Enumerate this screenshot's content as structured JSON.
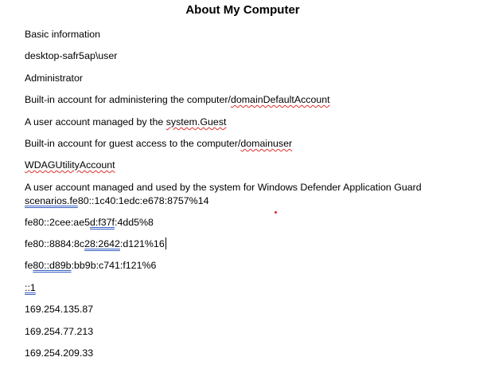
{
  "document": {
    "title": "About My Computer",
    "paragraphs": {
      "basic_info": "Basic information",
      "machine_user": "desktop-safr5ap\\user",
      "administrator": "Administrator",
      "admin_desc_prefix": "Built-in account for administering the computer/",
      "admin_desc_word": "domainDefaultAccount",
      "managed_prefix": "A user account managed by the ",
      "managed_word": "system.Guest",
      "guest_prefix": "Built-in account for guest access to the computer/",
      "guest_word": "domainuser",
      "wdag": "WDAGUtilityAccount",
      "wdag_desc_line1": "A user account managed and used by the system for Windows Defender Application Guard",
      "wdag_desc_word": "scenarios.fe",
      "wdag_desc_rest": "80::1c40:1edc:e678:8757%14",
      "ipv6_2_a": "fe80::2cee:ae5",
      "ipv6_2_b": "d:f37f",
      "ipv6_2_c": ":4dd5%8",
      "ipv6_3_a": "fe80::8884:8c",
      "ipv6_3_b": "28:2642",
      "ipv6_3_c": ":d121%16",
      "ipv6_4_a": "fe",
      "ipv6_4_b": "80::d89b",
      "ipv6_4_c": ":bb9b:c741:f121%6",
      "loopback": "::1",
      "ipv4_1": "169.254.135.87",
      "ipv4_2": "169.254.77.213",
      "ipv4_3": "169.254.209.33"
    }
  },
  "colors": {
    "spellcheck_underline": "#e03030",
    "grammar_underline": "#3b63c4",
    "text": "#000000",
    "background": "#ffffff"
  }
}
